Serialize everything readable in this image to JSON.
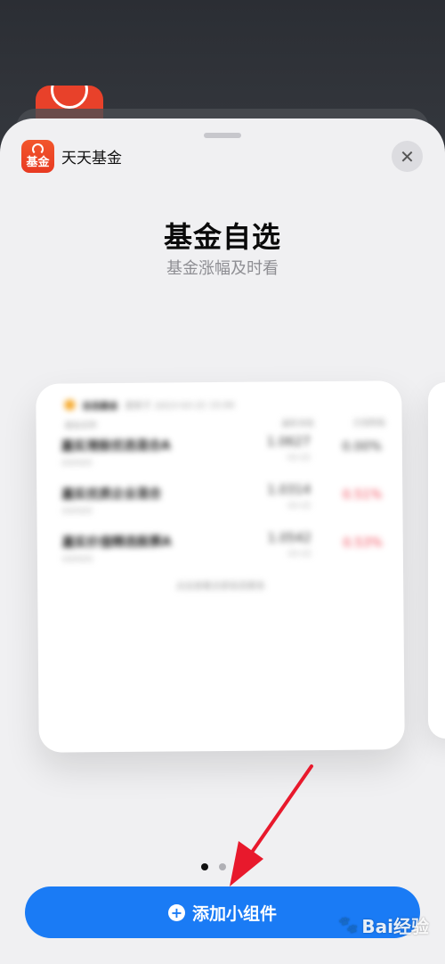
{
  "sheet": {
    "app_name": "天天基金",
    "app_icon_text": "基金",
    "close_glyph": "✕",
    "title": "基金自选",
    "subtitle": "基金涨幅及时看"
  },
  "widget_preview": {
    "header_name": "自选基金",
    "header_time": "更新于 2023-03-22 15:00",
    "columns": [
      "基金名称",
      "最新净值",
      "日涨跌幅"
    ],
    "rows": [
      {
        "name": "嘉实港股优选混合A",
        "code": "000000",
        "nav": "1.0627",
        "date": "03-22",
        "change": "0.00%",
        "up": false
      },
      {
        "name": "嘉实优质企业混合",
        "code": "000000",
        "nav": "1.0314",
        "date": "03-22",
        "change": "0.51%",
        "up": true
      },
      {
        "name": "嘉实价值精选股票A",
        "code": "000000",
        "nav": "1.0542",
        "date": "03-22",
        "change": "0.53%",
        "up": true
      }
    ],
    "footer": "点击查看全部自选基金"
  },
  "pager": {
    "count": 2,
    "active": 0
  },
  "add_button": {
    "label": "添加小组件",
    "icon": "plus-circle-icon"
  },
  "watermark": {
    "text": "Bai经验"
  },
  "colors": {
    "accent": "#1a7bf5",
    "app_brand": "#e8412a",
    "arrow": "#e8192c",
    "up": "#f04050"
  }
}
